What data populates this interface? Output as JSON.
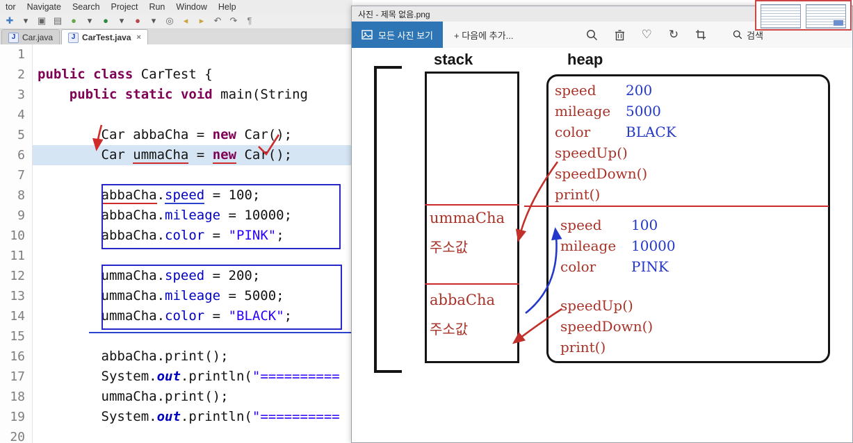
{
  "ide": {
    "menu_items": [
      "tor",
      "Navigate",
      "Search",
      "Project",
      "Run",
      "Window",
      "Help"
    ],
    "toolbar_icons": [
      {
        "name": "new",
        "glyph": "✚",
        "color": "#3f7cc1"
      },
      {
        "name": "new-dropdown",
        "glyph": "▾",
        "color": "#555555"
      },
      {
        "name": "save",
        "glyph": "▣",
        "color": "#666666"
      },
      {
        "name": "print",
        "glyph": "▤",
        "color": "#666666"
      },
      {
        "name": "debug",
        "glyph": "●",
        "color": "#69a74e"
      },
      {
        "name": "debug-dropdown",
        "glyph": "▾",
        "color": "#555555"
      },
      {
        "name": "run",
        "glyph": "●",
        "color": "#2d8a43"
      },
      {
        "name": "run-dropdown",
        "glyph": "▾",
        "color": "#555555"
      },
      {
        "name": "profile",
        "glyph": "●",
        "color": "#b5494c"
      },
      {
        "name": "profile-dropdown",
        "glyph": "▾",
        "color": "#555555"
      },
      {
        "name": "search",
        "glyph": "◎",
        "color": "#666666"
      },
      {
        "name": "prev-annotation",
        "glyph": "◂",
        "color": "#caa53d"
      },
      {
        "name": "next-annotation",
        "glyph": "▸",
        "color": "#caa53d"
      },
      {
        "name": "undo",
        "glyph": "↶",
        "color": "#666666"
      },
      {
        "name": "redo",
        "glyph": "↷",
        "color": "#666666"
      },
      {
        "name": "show-whitespace",
        "glyph": "¶",
        "color": "#888888"
      }
    ],
    "tabs": [
      {
        "label": "Car.java",
        "active": false
      },
      {
        "label": "CarTest.java",
        "active": true
      }
    ],
    "highlighted_line": 6,
    "code_lines": [
      [],
      [
        [
          "public",
          "k"
        ],
        [
          " ",
          "p"
        ],
        [
          "class",
          "k"
        ],
        [
          " CarTest {",
          "p"
        ]
      ],
      [
        [
          "    ",
          "p"
        ],
        [
          "public",
          "k"
        ],
        [
          " ",
          "p"
        ],
        [
          "static",
          "k"
        ],
        [
          " ",
          "p"
        ],
        [
          "void",
          "k"
        ],
        [
          " main(String",
          "p"
        ]
      ],
      [],
      [
        [
          "        Car abbaCha = ",
          "p"
        ],
        [
          "new",
          "k"
        ],
        [
          " Car();",
          "p"
        ]
      ],
      [
        [
          "        Car ",
          "p"
        ],
        [
          "ummaCha",
          "p ru"
        ],
        [
          " = ",
          "p"
        ],
        [
          "new",
          "k ru"
        ],
        [
          " Car();",
          "p"
        ]
      ],
      [],
      [
        [
          "        ",
          "p"
        ],
        [
          "abbaCha",
          "p ru"
        ],
        [
          ".",
          "p"
        ],
        [
          "speed",
          "f bu"
        ],
        [
          " = 100;",
          "p"
        ]
      ],
      [
        [
          "        abbaCha.",
          "p"
        ],
        [
          "mileage",
          "f"
        ],
        [
          " = 10000;",
          "p"
        ]
      ],
      [
        [
          "        abbaCha.",
          "p"
        ],
        [
          "color",
          "f"
        ],
        [
          " = ",
          "p"
        ],
        [
          "\"PINK\"",
          "s"
        ],
        [
          ";",
          "p"
        ]
      ],
      [],
      [
        [
          "        ummaCha.",
          "p"
        ],
        [
          "speed",
          "f"
        ],
        [
          " = 200;",
          "p"
        ]
      ],
      [
        [
          "        ummaCha.",
          "p"
        ],
        [
          "mileage",
          "f"
        ],
        [
          " = 5000;",
          "p"
        ]
      ],
      [
        [
          "        ummaCha.",
          "p"
        ],
        [
          "color",
          "f"
        ],
        [
          " = ",
          "p"
        ],
        [
          "\"BLACK\"",
          "s"
        ],
        [
          ";",
          "p"
        ]
      ],
      [],
      [
        [
          "        abbaCha.print();",
          "p"
        ]
      ],
      [
        [
          "        System.",
          "p"
        ],
        [
          "out",
          "o"
        ],
        [
          ".println(",
          "p"
        ],
        [
          "\"==========",
          "s"
        ]
      ],
      [
        [
          "        ummaCha.print();",
          "p"
        ]
      ],
      [
        [
          "        System.",
          "p"
        ],
        [
          "out",
          "o"
        ],
        [
          ".println(",
          "p"
        ],
        [
          "\"==========",
          "s"
        ]
      ],
      []
    ]
  },
  "photo_viewer": {
    "title": "사진 - 제목 없음.png",
    "toolbar": {
      "view_all_label": "모든 사진 보기",
      "add_label": "+ 다음에 추가...",
      "search_label": "검색"
    },
    "diagram": {
      "stack_label": "stack",
      "heap_label": "heap",
      "stack_items": [
        {
          "name": "ummaCha",
          "addr_label": "주소값"
        },
        {
          "name": "abbaCha",
          "addr_label": "주소값"
        }
      ],
      "heap_objects": [
        {
          "fields": [
            {
              "name": "speed",
              "value": "200"
            },
            {
              "name": "mileage",
              "value": "5000"
            },
            {
              "name": "color",
              "value": "BLACK"
            }
          ],
          "methods": [
            "speedUp()",
            "speedDown()",
            "print()"
          ]
        },
        {
          "fields": [
            {
              "name": "speed",
              "value": "100"
            },
            {
              "name": "mileage",
              "value": "10000"
            },
            {
              "name": "color",
              "value": "PINK"
            }
          ],
          "methods": [
            "speedUp()",
            "speedDown()",
            "print()"
          ]
        }
      ]
    }
  },
  "colors": {
    "keyword": "#7f0055",
    "field": "#0000c0",
    "string": "#2a00ff",
    "annotation_red": "#cf2b2b",
    "annotation_blue": "#2626c9",
    "diagram_red": "#a83228",
    "diagram_blue": "#2338c8",
    "photos_accent": "#2e75b6",
    "line_highlight": "#d6e5f3"
  }
}
